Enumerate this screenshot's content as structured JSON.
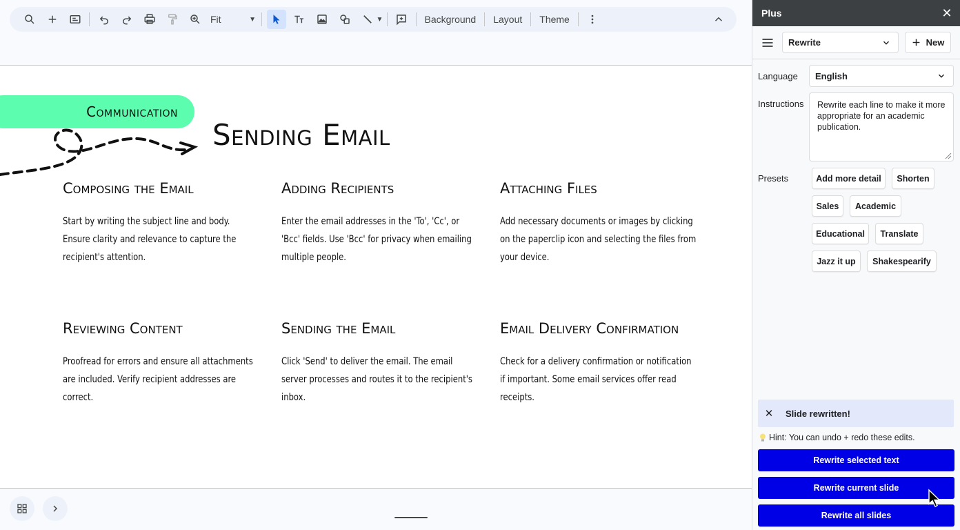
{
  "toolbar": {
    "zoom_value": "Fit",
    "background_label": "Background",
    "layout_label": "Layout",
    "theme_label": "Theme"
  },
  "slide": {
    "tag": "Communication",
    "title": "Sending Email",
    "cards": [
      {
        "heading": "Composing the Email",
        "body": "Start by writing the subject line and body. Ensure clarity and relevance to capture the recipient's attention."
      },
      {
        "heading": "Adding Recipients",
        "body": "Enter the email addresses in the 'To', 'Cc', or 'Bcc' fields. Use 'Bcc' for privacy when emailing multiple people."
      },
      {
        "heading": "Attaching Files",
        "body": "Add necessary documents or images by clicking on the paperclip icon and selecting the files from your device."
      },
      {
        "heading": "Reviewing Content",
        "body": "Proofread for errors and ensure all attachments are included. Verify recipient addresses are correct."
      },
      {
        "heading": "Sending the Email",
        "body": "Click 'Send' to deliver the email. The email server processes and routes it to the recipient's inbox."
      },
      {
        "heading": "Email Delivery Confirmation",
        "body": "Check for a delivery confirmation or notification if important. Some email services offer read receipts."
      }
    ]
  },
  "panel": {
    "title": "Plus",
    "mode_value": "Rewrite",
    "new_label": "New",
    "language_label": "Language",
    "language_value": "English",
    "instructions_label": "Instructions",
    "instructions_value": "Rewrite each line to make it more appropriate for an academic publication.",
    "presets_label": "Presets",
    "presets": [
      "Add more detail",
      "Shorten",
      "Sales",
      "Academic",
      "Educational",
      "Translate",
      "Jazz it up",
      "Shakespearify"
    ],
    "toast_message": "Slide rewritten!",
    "hint": "Hint: You can undo + redo these edits.",
    "actions": [
      "Rewrite selected text",
      "Rewrite current slide",
      "Rewrite all slides"
    ]
  },
  "colors": {
    "accent_pill": "#5dfdb0",
    "action_button": "#0000e6",
    "panel_header": "#3c4043",
    "toast_bg": "#e3e8fa"
  }
}
